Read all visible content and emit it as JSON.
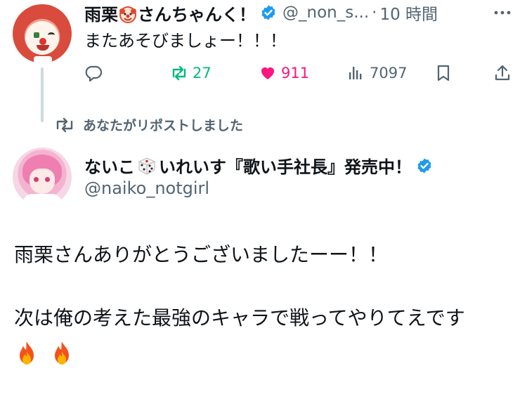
{
  "tweet": {
    "author_name_part1": "雨栗",
    "author_name_part2": "さんちゃんく！",
    "emoji_name": "clown-face",
    "handle": "@_non_s...",
    "separator": "·",
    "time": "10 時間",
    "text": "またあそびましょー！！！",
    "actions": {
      "reposts": "27",
      "likes": "911",
      "views": "7097"
    }
  },
  "repost_banner": {
    "text": "あなたがリポストしました"
  },
  "quoted": {
    "name_part1": "ないこ",
    "emoji_name": "game-die",
    "name_part2": "いれいす『歌い手社長』発売中！",
    "handle": "@naiko_notgirl",
    "body_line1": "雨栗さんありがとうございましたーー！！",
    "body_line2": "次は俺の考えた最強のキャラで戦ってやりてえです",
    "trailing_emoji": [
      "fire",
      "fire"
    ]
  },
  "colors": {
    "text": "#0f1419",
    "secondary": "#536471",
    "repost": "#00ba7c",
    "like": "#f91880",
    "verified": "#1d9bf0"
  }
}
